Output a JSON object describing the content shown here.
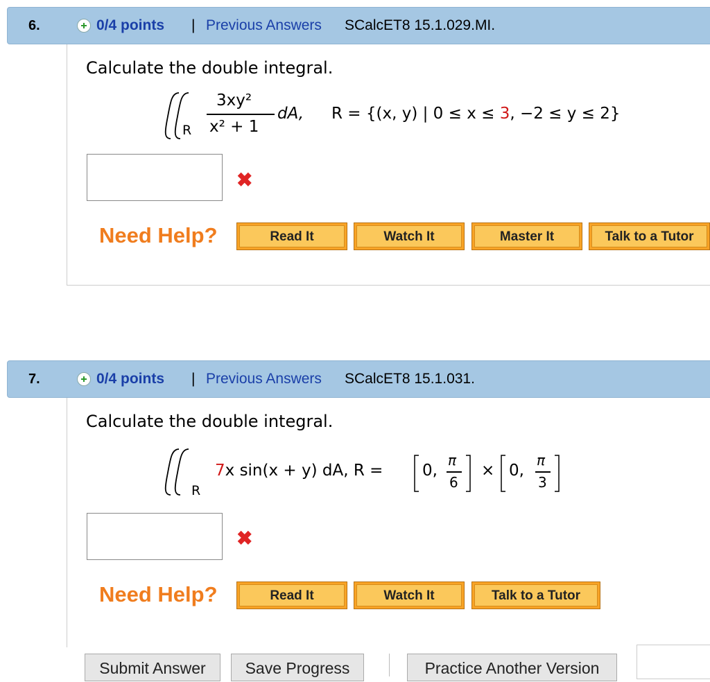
{
  "questions": [
    {
      "number": "6.",
      "points": "0/4 points",
      "separator": "|",
      "previous_answers": "Previous Answers",
      "reference": "SCalcET8 15.1.029.MI.",
      "prompt": "Calculate the double integral.",
      "math": {
        "numerator": "3xy²",
        "denominator": "x² + 1",
        "dA": "dA,",
        "region_label": "R",
        "region_prefix": "R = {(x, y) | 0 ≤ x ≤ ",
        "region_highlight": "3",
        "region_suffix": ", −2 ≤ y ≤ 2}"
      },
      "answer_value": "",
      "status_icon": "x-mark-icon",
      "need_help": "Need Help?",
      "help_buttons": [
        "Read It",
        "Watch It",
        "Master It",
        "Talk to a Tutor"
      ]
    },
    {
      "number": "7.",
      "points": "0/4 points",
      "separator": "|",
      "previous_answers": "Previous Answers",
      "reference": "SCalcET8 15.1.031.",
      "prompt": "Calculate the double integral.",
      "math": {
        "coefficient": "7",
        "integrand": "x sin(x + y) dA, R = ",
        "region_label": "R",
        "interval1_start": "0,",
        "pi": "π",
        "denom1": "6",
        "times": "×",
        "interval2_start": "0,",
        "denom2": "3"
      },
      "answer_value": "",
      "status_icon": "x-mark-icon",
      "need_help": "Need Help?",
      "help_buttons": [
        "Read It",
        "Watch It",
        "Talk to a Tutor"
      ]
    }
  ],
  "footer": {
    "submit": "Submit Answer",
    "save": "Save Progress",
    "practice": "Practice Another Version"
  },
  "colors": {
    "header_bg": "#a5c7e3",
    "link_blue": "#1a3fa8",
    "help_orange": "#f07d1e",
    "button_orange": "#f8a326",
    "error_red": "#e02424",
    "highlight_red": "#d01818"
  }
}
